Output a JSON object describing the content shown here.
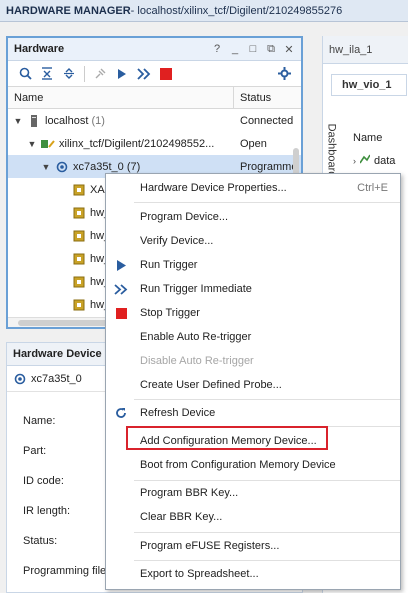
{
  "titlebar": {
    "title": "HARDWARE MANAGER",
    "path": " - localhost/xilinx_tcf/Digilent/210249855276"
  },
  "hardware_panel": {
    "title": "Hardware",
    "controls": [
      "?",
      "_",
      "□",
      "⧉",
      "✕"
    ],
    "columns": [
      "Name",
      "Status"
    ],
    "rows": [
      {
        "name": "localhost",
        "count": "(1)",
        "status": "Connected",
        "icon": "server-icon"
      },
      {
        "name": "xilinx_tcf/Digilent/2102498552...",
        "status": "Open",
        "icon": "cable-icon"
      },
      {
        "name": "xc7a35t_0",
        "count": "(7)",
        "status": "Programme",
        "icon": "chip-icon"
      },
      {
        "name": "XAD",
        "icon": "debug-core-icon"
      },
      {
        "name": "hw_",
        "icon": "debug-core-icon"
      },
      {
        "name": "hw_",
        "icon": "debug-core-icon"
      },
      {
        "name": "hw_",
        "icon": "debug-core-icon"
      },
      {
        "name": "hw_",
        "icon": "debug-core-icon"
      },
      {
        "name": "hw_",
        "icon": "debug-core-icon"
      }
    ]
  },
  "device_panel": {
    "title": "Hardware Device",
    "device": "xc7a35t_0",
    "props": [
      "Name:",
      "Part:",
      "ID code:",
      "IR length:",
      "Status:",
      "Programming file"
    ]
  },
  "right_panel": {
    "tab": "hw_ila_1",
    "subtab": "hw_vio_1",
    "vertical_label": "Dashboard Options",
    "header": "Name",
    "row": "data"
  },
  "context_menu": {
    "items": [
      {
        "label": "Hardware Device Properties...",
        "shortcut": "Ctrl+E"
      },
      {
        "label": "Program Device..."
      },
      {
        "label": "Verify Device..."
      },
      {
        "label": "Run Trigger",
        "icon": "run-trigger-icon"
      },
      {
        "label": "Run Trigger Immediate",
        "icon": "run-trigger-immediate-icon"
      },
      {
        "label": "Stop Trigger",
        "icon": "stop-trigger-icon"
      },
      {
        "label": "Enable Auto Re-trigger"
      },
      {
        "label": "Disable Auto Re-trigger",
        "disabled": true
      },
      {
        "label": "Create User Defined Probe..."
      },
      {
        "label": "Refresh Device",
        "icon": "refresh-icon"
      },
      {
        "label": "Add Configuration Memory Device..."
      },
      {
        "label": "Boot from Configuration Memory Device"
      },
      {
        "label": "Program BBR Key..."
      },
      {
        "label": "Clear BBR Key..."
      },
      {
        "label": "Program eFUSE Registers..."
      },
      {
        "label": "Export to Spreadsheet..."
      }
    ]
  },
  "colors": {
    "accent": "#2a5d9f",
    "stop": "#e02020",
    "highlight": "#d9232c",
    "selection": "#cfe0f5"
  }
}
